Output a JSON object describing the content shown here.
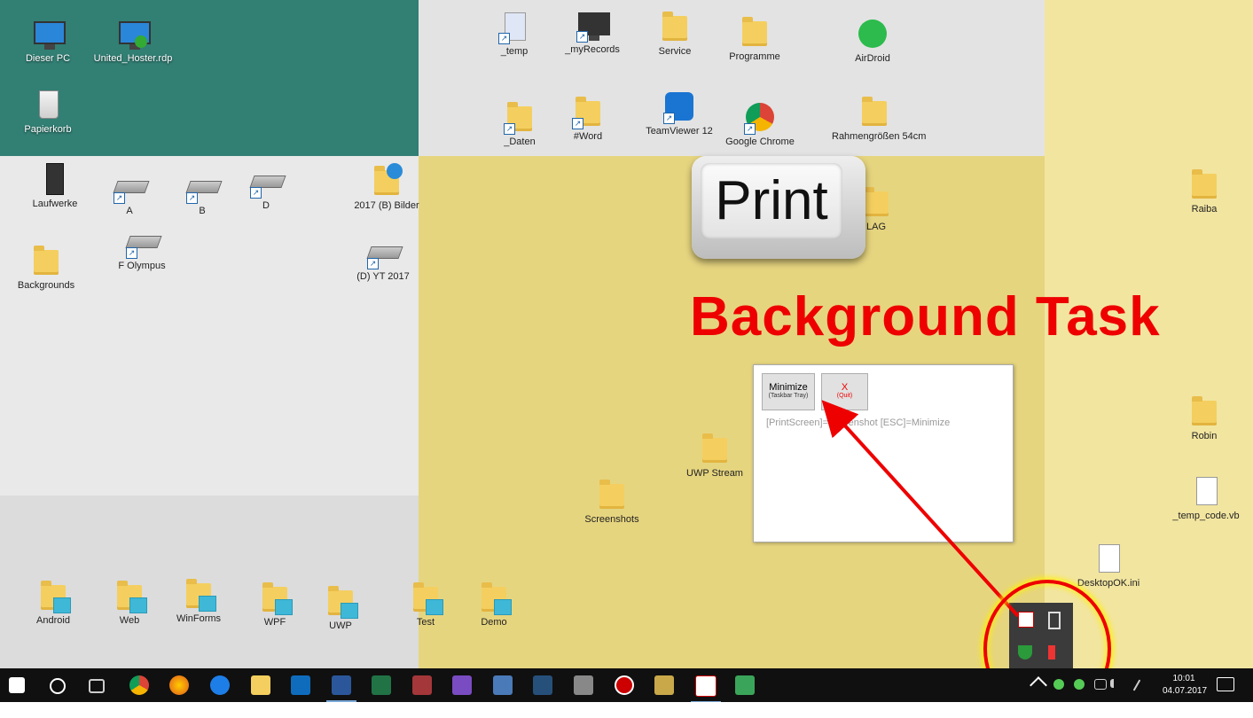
{
  "desktop": {
    "icons": [
      {
        "label": "Dieser PC"
      },
      {
        "label": "United_Hoster.rdp"
      },
      {
        "label": "Papierkorb"
      },
      {
        "label": "_temp"
      },
      {
        "label": "_myRecords"
      },
      {
        "label": "Service"
      },
      {
        "label": "Programme"
      },
      {
        "label": "AirDroid"
      },
      {
        "label": "_Daten"
      },
      {
        "label": "#Word"
      },
      {
        "label": "TeamViewer 12"
      },
      {
        "label": "Google Chrome"
      },
      {
        "label": "Rahmengrößen 54cm"
      },
      {
        "label": "Laufwerke"
      },
      {
        "label": "A"
      },
      {
        "label": "B"
      },
      {
        "label": "D"
      },
      {
        "label": "2017 (B) Bilder"
      },
      {
        "label": "F Olympus"
      },
      {
        "label": "(D) YT 2017"
      },
      {
        "label": "Backgrounds"
      },
      {
        "label": "LAG"
      },
      {
        "label": "Raiba"
      },
      {
        "label": "UWP Stream"
      },
      {
        "label": "Screenshots"
      },
      {
        "label": "Robin"
      },
      {
        "label": "_temp_code.vb"
      },
      {
        "label": "DesktopOK.ini"
      },
      {
        "label": "Android"
      },
      {
        "label": "Web"
      },
      {
        "label": "WinForms"
      },
      {
        "label": "WPF"
      },
      {
        "label": "UWP"
      },
      {
        "label": "Test"
      },
      {
        "label": "Demo"
      }
    ]
  },
  "overlay": {
    "print_key_label": "Print",
    "headline": "Background Task"
  },
  "app_window": {
    "minimize_label": "Minimize",
    "minimize_sub": "(Taskbar Tray)",
    "quit_label": "X",
    "quit_sub": "(Quit)",
    "hint": "[PrintScreen]=Screenshot  [ESC]=Minimize"
  },
  "taskbar": {
    "icons": [
      "start-icon",
      "cortana-icon",
      "task-view-icon",
      "chrome-icon",
      "firefox-icon",
      "edge-icon",
      "explorer-icon",
      "outlook-icon",
      "word-icon",
      "excel-icon",
      "access-icon",
      "visual-studio-icon",
      "remote-desktop-icon",
      "pen-tool-icon",
      "film-icon",
      "record-icon",
      "film-strip-icon",
      "screenshot-app-icon",
      "paint-icon"
    ],
    "time": "10:01",
    "date": "04.07.2017"
  },
  "colors": {
    "teal": "#327f74",
    "yellow": "#e6d57f",
    "accent_red": "#ee0000"
  }
}
